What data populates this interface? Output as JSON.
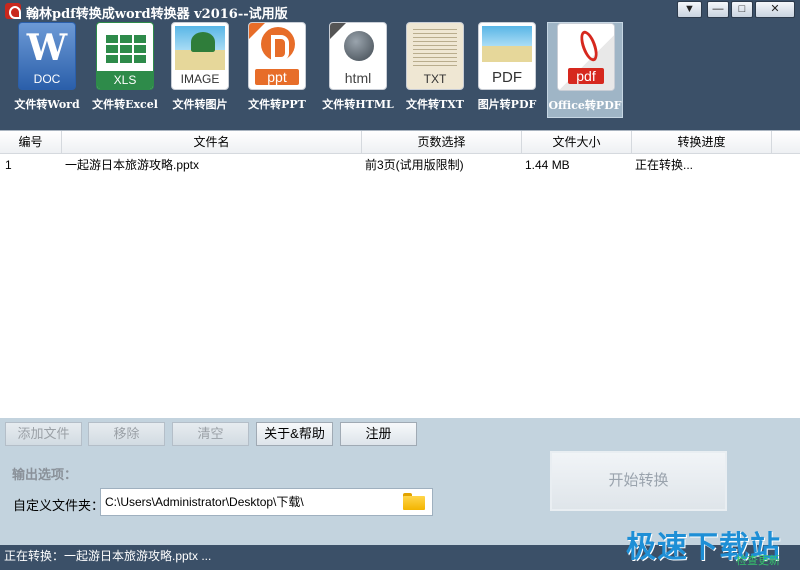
{
  "window": {
    "title": "翰林pdf转换成word转换器 v2016--试用版",
    "controls": {
      "menu": "▼",
      "minimize": "—",
      "maximize": "□",
      "close": "✕"
    }
  },
  "toolbar": {
    "items": [
      {
        "label": "文件转Word",
        "icon_text": "W",
        "icon_sub": "DOC",
        "icon": "word-doc-icon"
      },
      {
        "label": "文件转Excel",
        "icon_sub": "XLS",
        "icon": "excel-xls-icon"
      },
      {
        "label": "文件转图片",
        "icon_sub": "IMAGE",
        "icon": "image-icon"
      },
      {
        "label": "文件转PPT",
        "icon_sub": "ppt",
        "icon": "ppt-icon"
      },
      {
        "label": "文件转HTML",
        "icon_sub": "html",
        "icon": "html-icon"
      },
      {
        "label": "文件转TXT",
        "icon_sub": "TXT",
        "icon": "txt-icon"
      },
      {
        "label": "图片转PDF",
        "icon_sub": "PDF",
        "icon": "pdf-icon"
      },
      {
        "label": "Office转PDF",
        "icon_sub": "pdf",
        "icon": "office-pdf-icon",
        "active": true
      }
    ]
  },
  "table": {
    "columns": [
      "编号",
      "文件名",
      "页数选择",
      "文件大小",
      "转换进度"
    ],
    "rows": [
      {
        "index": "1",
        "filename": "一起游日本旅游攻略.pptx",
        "pages": "前3页(试用版限制)",
        "size": "1.44 MB",
        "progress": "正在转换..."
      }
    ]
  },
  "actions": {
    "add_file": "添加文件",
    "remove": "移除",
    "clear": "清空",
    "about_help": "关于&帮助",
    "register": "注册"
  },
  "output": {
    "title": "输出选项：",
    "folder_label": "自定义文件夹：",
    "folder_path": "C:\\Users\\Administrator\\Desktop\\下载\\"
  },
  "start_button": "开始转换",
  "status": {
    "text": "正在转换：一起游日本旅游攻略.pptx ..."
  },
  "watermark": {
    "text": "极速下载站",
    "check_update": "检查更新"
  },
  "colors": {
    "titlebar": "#3b5068",
    "panel": "#c3d3de",
    "watermark": "#1e8fd6",
    "check_update": "#35c46b"
  }
}
